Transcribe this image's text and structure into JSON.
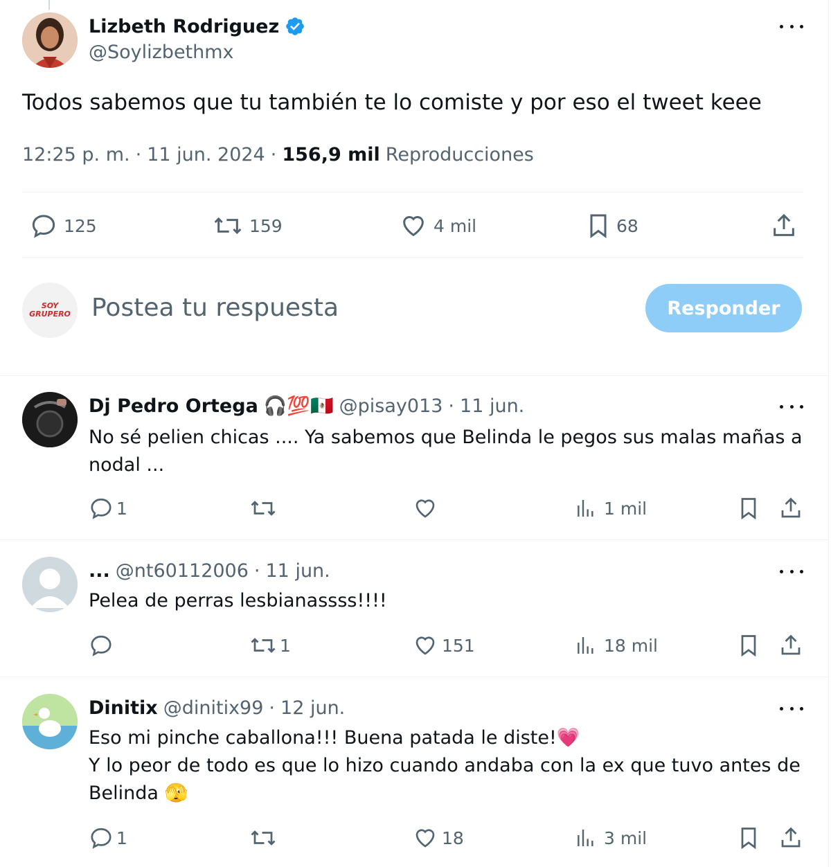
{
  "tweet": {
    "author_name": "Lizbeth Rodriguez",
    "author_handle": "@Soylizbethmx",
    "text": "Todos sabemos que tu también te lo comiste y por eso el tweet keee",
    "time": "12:25 p. m.",
    "sep1": "·",
    "date": "11 jun. 2024",
    "sep2": "·",
    "views_count": "156,9 mil",
    "views_label": "Reproducciones",
    "stats": {
      "replies": "125",
      "reposts": "159",
      "likes": "4 mil",
      "bookmarks": "68"
    }
  },
  "composer": {
    "placeholder": "Postea tu respuesta",
    "reply_button": "Responder",
    "avatar_text": "SOY GRUPERO"
  },
  "replies": [
    {
      "name": "Dj Pedro Ortega",
      "emojis": "🎧💯🇲🇽",
      "handle": "@pisay013",
      "sep": "·",
      "date": "11 jun.",
      "text_lines": [
        "No sé pelien chicas .... Ya sabemos que Belinda le pegos sus malas mañas a",
        "nodal ..."
      ],
      "replies": "1",
      "reposts": "",
      "likes": "",
      "views": "1 mil"
    },
    {
      "name": "...",
      "handle": "@nt60112006",
      "sep": "·",
      "date": "11 jun.",
      "text_lines": [
        "Pelea de perras lesbianassss!!!!"
      ],
      "replies": "",
      "reposts": "1",
      "likes": "151",
      "views": "18 mil"
    },
    {
      "name": "Dinitix",
      "handle": "@dinitix99",
      "sep": "·",
      "date": "12 jun.",
      "text_lines": [
        "Eso mi pinche caballona!!! Buena patada le diste!💗",
        "Y lo peor de todo es que lo hizo cuando andaba con la ex que tuvo antes de",
        "Belinda 🫣"
      ],
      "replies": "1",
      "reposts": "",
      "likes": "18",
      "views": "3 mil"
    }
  ],
  "colors": {
    "verified": "#1d9bf0",
    "muted": "#536471",
    "button": "#8ecdf8"
  }
}
